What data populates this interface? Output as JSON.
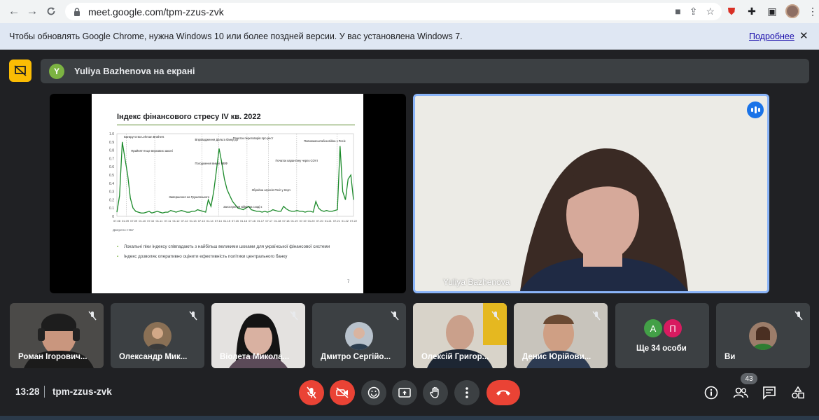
{
  "browser": {
    "url": "meet.google.com/tpm-zzus-zvk",
    "infobar_message": "Чтобы обновлять Google Chrome, нужна Windows 10 или более поздней версии. У вас установлена Windows 7.",
    "infobar_link": "Подробнее"
  },
  "presenting": {
    "avatar_letter": "Y",
    "text": "Yuliya Bazhenova на екрані"
  },
  "slide": {
    "title": "Індекс фінансового стресу IV кв. 2022",
    "source": "Джерело: НБУ",
    "bullets": [
      "Локальні піки індексу співпадають з найбільш великими шоками для української фінансової системи",
      "Індекс дозволяє оперативно оцінити ефективність політики центрального банку"
    ],
    "page": "7",
    "annotations": [
      "Банкрутство Lehman Brothers",
      "Прийняття ще верхових законів за вимогою МВФ",
      "Впровадження Дельта банку до тимчасової адміністрації; місяці поспіль",
      "Погодження вимог МВФ",
      "Завершення на Грушевського",
      "Початок переговорів про реструктуризацію зовнішнього боргу",
      "Загострення війни на сході країни",
      "Збройна агресія Росії у Керченській протоці",
      "Початок карантину через COVID-19",
      "Повномасштабна війна з Росією"
    ]
  },
  "chart_data": {
    "type": "line",
    "title": "Індекс фінансового стресу IV кв. 2022",
    "ylim": [
      0,
      1.0
    ],
    "y_ticks": [
      "0",
      "0.1",
      "0.2",
      "0.3",
      "0.4",
      "0.5",
      "0.6",
      "0.7",
      "0.8",
      "0.9",
      "1.0"
    ],
    "x_ticks": [
      "07.08",
      "01.09",
      "07.09",
      "01.10",
      "07.10",
      "01.11",
      "07.11",
      "01.12",
      "07.12",
      "01.13",
      "07.13",
      "01.14",
      "07.14",
      "01.15",
      "07.15",
      "01.16",
      "07.16",
      "01.17",
      "07.17",
      "01.18",
      "07.18",
      "01.19",
      "07.19",
      "01.20",
      "07.20",
      "01.21",
      "07.21",
      "01.22",
      "07.22"
    ],
    "series": [
      {
        "values": [
          0.05,
          0.25,
          0.9,
          0.7,
          0.5,
          0.22,
          0.1,
          0.06,
          0.05,
          0.04,
          0.04,
          0.05,
          0.06,
          0.04,
          0.05,
          0.06,
          0.05,
          0.04,
          0.05,
          0.05,
          0.07,
          0.06,
          0.05,
          0.06,
          0.07,
          0.06,
          0.05,
          0.05,
          0.06,
          0.06,
          0.08,
          0.07,
          0.06,
          0.05,
          0.2,
          0.12,
          0.3,
          0.55,
          0.82,
          0.65,
          0.45,
          0.32,
          0.25,
          0.18,
          0.14,
          0.1,
          0.09,
          0.08,
          0.1,
          0.12,
          0.08,
          0.07,
          0.06,
          0.06,
          0.05,
          0.06,
          0.05,
          0.06,
          0.08,
          0.07,
          0.06,
          0.06,
          0.12,
          0.09,
          0.07,
          0.06,
          0.06,
          0.07,
          0.06,
          0.06,
          0.05,
          0.06,
          0.06,
          0.05,
          0.18,
          0.1,
          0.07,
          0.06,
          0.07,
          0.06,
          0.06,
          0.07,
          0.08,
          0.85,
          0.3,
          0.2,
          0.45,
          0.5,
          0.2
        ]
      }
    ]
  },
  "speaker": {
    "name": "Yuliya Bazhenova"
  },
  "participants": [
    {
      "name": "Роман Ігорович..."
    },
    {
      "name": "Олександр Мик..."
    },
    {
      "name": "Віолета Микола..."
    },
    {
      "name": "Дмитро Сергійо..."
    },
    {
      "name": "Олексій Григор..."
    },
    {
      "name": "Денис Юрійови..."
    },
    {
      "name": "Ще 34 особи",
      "chips": [
        "А",
        "П"
      ]
    },
    {
      "name": "Ви"
    }
  ],
  "bottom": {
    "time": "13:28",
    "meeting_code": "tpm-zzus-zvk",
    "people_count": "43"
  },
  "colors": {
    "accent": "#8ab4f8",
    "danger": "#ea4335",
    "present": "#fbbc04",
    "chart_line": "#1b8a2a",
    "bg": "#202124"
  }
}
